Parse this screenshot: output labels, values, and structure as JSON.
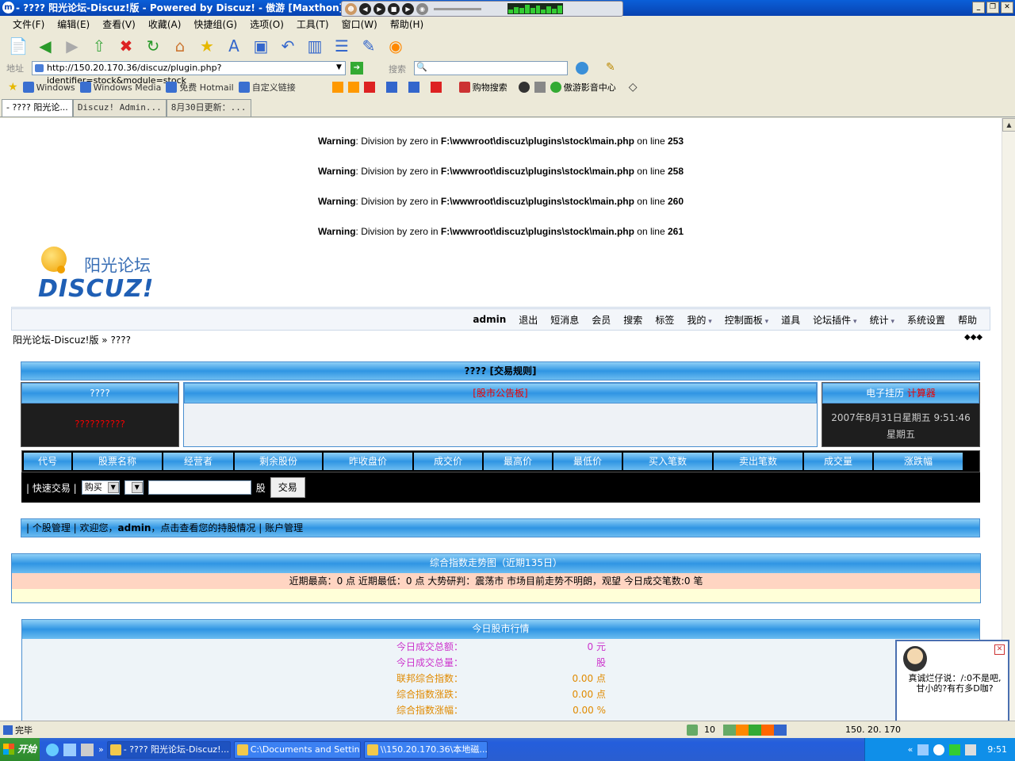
{
  "window": {
    "title": "- ???? 阳光论坛-Discuz!版 - Powered by Discuz! - 傲游 [Maxthon]"
  },
  "menu": [
    "文件(F)",
    "编辑(E)",
    "查看(V)",
    "收藏(A)",
    "快捷组(G)",
    "选项(O)",
    "工具(T)",
    "窗口(W)",
    "帮助(H)"
  ],
  "address": {
    "label": "地址",
    "url": "http://150.20.170.36/discuz/plugin.php?identifier=stock&module=stock",
    "search_label": "搜索"
  },
  "favorites": [
    "Windows",
    "Windows Media",
    "免费 Hotmail",
    "自定义链接",
    "购物搜索",
    "傲游影音中心"
  ],
  "tabs": [
    "- ???? 阳光论...",
    "Discuz! Admin...",
    "8月30日更新：..."
  ],
  "warnings": [
    {
      "prefix": "Warning",
      "text": ": Division by zero in ",
      "file": "F:\\wwwroot\\discuz\\plugins\\stock\\main.php",
      "online": " on line ",
      "line": "253"
    },
    {
      "prefix": "Warning",
      "text": ": Division by zero in ",
      "file": "F:\\wwwroot\\discuz\\plugins\\stock\\main.php",
      "online": " on line ",
      "line": "258"
    },
    {
      "prefix": "Warning",
      "text": ": Division by zero in ",
      "file": "F:\\wwwroot\\discuz\\plugins\\stock\\main.php",
      "online": " on line ",
      "line": "260"
    },
    {
      "prefix": "Warning",
      "text": ": Division by zero in ",
      "file": "F:\\wwwroot\\discuz\\plugins\\stock\\main.php",
      "online": " on line ",
      "line": "261"
    }
  ],
  "logo": {
    "name": "阳光论坛",
    "brand": "DISCUZ!"
  },
  "nav": {
    "user": "admin",
    "items": [
      "退出",
      "短消息",
      "会员",
      "搜索",
      "标签",
      "我的",
      "控制面板",
      "道具",
      "论坛插件",
      "统计",
      "系统设置",
      "帮助"
    ],
    "dropdown": [
      "我的",
      "控制面板",
      "论坛插件",
      "统计"
    ]
  },
  "breadcrumb": {
    "home": "阳光论坛-Discuz!版",
    "sep": " » ",
    "current": "????",
    "arrows": "◆◆◆"
  },
  "stock": {
    "title": "???? [交易规则]",
    "left_title": "????",
    "left_body": "??????????",
    "mid_title": "股市公告板",
    "right_title": "电子挂历",
    "right_link": "计算器",
    "datetime": "2007年8月31日星期五  9:51:46 星期五",
    "columns": [
      "代号",
      "股票名称",
      "经营者",
      "剩余股份",
      "昨收盘价",
      "成交价",
      "最高价",
      "最低价",
      "买入笔数",
      "卖出笔数",
      "成交量",
      "涨跌幅"
    ],
    "quick_label": "| 快速交易 |",
    "trade_type": "购买",
    "unit": "股",
    "trade_button": "交易",
    "userbar": {
      "p1": "| 个股管理 | 欢迎您，",
      "user": "admin",
      "p2": "，点击查看您的持股情况 | 账户管理"
    },
    "index_title": "综合指数走势图（近期135日）",
    "index_summary": "近期最高：0 点    近期最低：0 点    大势研判：震荡市   市场目前走势不明朗，观望     今日成交笔数:0 笔",
    "market_title": "今日股市行情",
    "market_rows": [
      {
        "label": "今日成交总额：",
        "value": "0 元",
        "color": "#cc33cc"
      },
      {
        "label": "今日成交总量：",
        "value": "股",
        "color": "#cc33cc"
      },
      {
        "label": "联邦综合指数：",
        "value": "0.00 点",
        "color": "#e08a00"
      },
      {
        "label": "综合指数涨跌：",
        "value": "0.00 点",
        "color": "#e08a00"
      },
      {
        "label": "综合指数涨幅：",
        "value": "0.00 %",
        "color": "#e08a00"
      }
    ]
  },
  "popup": {
    "text": "真诚烂仔说：/:0不是吧, 甘小的?有冇多D咖?"
  },
  "statusbar": {
    "text": "完毕",
    "count": "10",
    "ip": "150. 20. 170"
  },
  "taskbar": {
    "start": "开始",
    "tasks": [
      "- ???? 阳光论坛-Discuz!...",
      "C:\\Documents and Settin...",
      "\\\\150.20.170.36\\本地磁..."
    ],
    "clock": "9:51"
  }
}
